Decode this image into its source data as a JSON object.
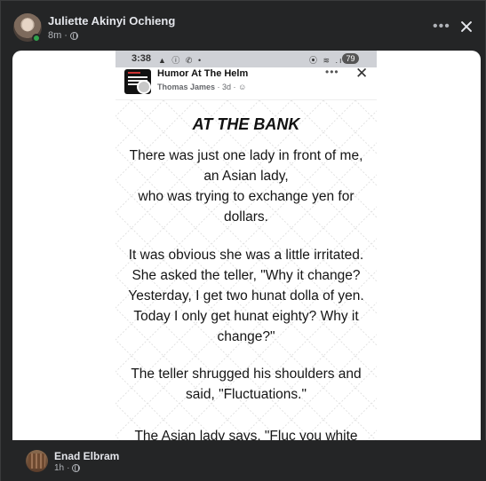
{
  "post": {
    "author": "Juliette Akinyi Ochieng",
    "time": "8m",
    "separator": "·",
    "more_label": "•••",
    "close_label": "close"
  },
  "phone": {
    "status_time": "3:38",
    "status_left_icons": "▲ ⓘ ✆ •",
    "status_right_icons": "⦿ ≋ .ıl",
    "battery": "79",
    "group_name": "Humor At The Helm",
    "poster": "Thomas James",
    "poster_time": "· 3d ·",
    "more_label": "•••",
    "close_label": "✕"
  },
  "joke": {
    "title": "AT THE BANK",
    "p1": [
      "There was just one lady in front of me,",
      "an Asian lady,",
      "who was trying to exchange yen for",
      "dollars."
    ],
    "p2": [
      "It was obvious she was a little irritated.",
      "She asked the teller, \"Why it change?",
      "Yesterday, I get two hunat dolla of yen.",
      "Today I only get hunat eighty? Why it",
      "change?\""
    ],
    "p3": [
      "The teller shrugged his shoulders and",
      "said, \"Fluctuations.\""
    ],
    "p4": [
      "The Asian lady says, \"Fluc you white"
    ]
  },
  "comment": {
    "author": "Enad Elbram",
    "time": "1h",
    "separator": "·"
  },
  "colors": {
    "background": "#242526",
    "text_primary": "#e4e6eb",
    "text_secondary": "#b0b3b8",
    "online": "#31a24c"
  }
}
